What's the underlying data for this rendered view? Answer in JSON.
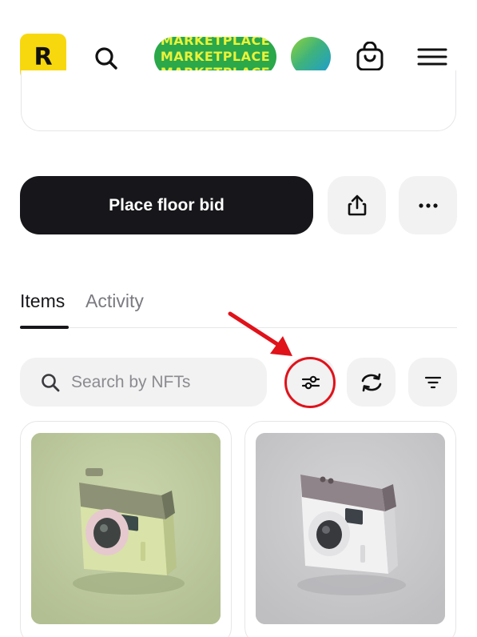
{
  "header": {
    "logo_letter": "R",
    "marketplace_badge": [
      "MARKETPLACE",
      "MARKETPLACE",
      "MARKETPLACE"
    ],
    "icons": [
      "search-icon",
      "avatar",
      "shopping-bag-icon",
      "hamburger-menu-icon"
    ]
  },
  "actions": {
    "place_floor_bid": "Place floor bid",
    "icons": [
      "share-icon",
      "more-icon"
    ]
  },
  "tabs": [
    {
      "label": "Items",
      "active": true
    },
    {
      "label": "Activity",
      "active": false
    }
  ],
  "filters": {
    "search_placeholder": "Search by NFTs",
    "icons": [
      "filter-sliders-icon",
      "refresh-icon",
      "sort-icon"
    ]
  },
  "colors": {
    "accent_yellow": "#f7d80f",
    "marketplace_green": "#2aa84a",
    "marketplace_text": "#e9f23a",
    "primary_dark": "#17171b",
    "annotation_red": "#e0121a"
  }
}
